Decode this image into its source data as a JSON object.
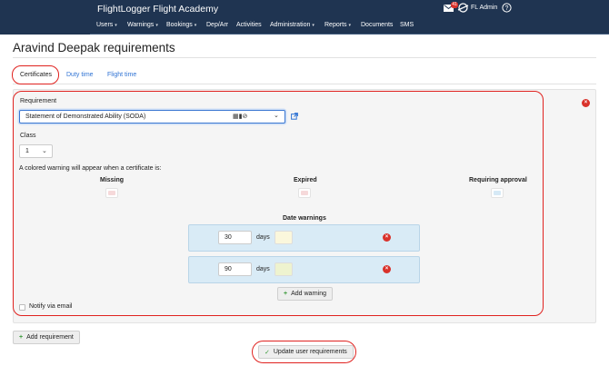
{
  "app": {
    "brand": "FlightLogger Flight Academy",
    "user_name": "FL Admin",
    "mail_badge": "41",
    "nav": [
      {
        "label": "Users",
        "dropdown": true
      },
      {
        "label": "Warnings",
        "dropdown": true
      },
      {
        "label": "Bookings",
        "dropdown": true
      },
      {
        "label": "Dep/Arr",
        "dropdown": false
      },
      {
        "label": "Activities",
        "dropdown": false
      },
      {
        "label": "Administration",
        "dropdown": true
      },
      {
        "label": "Reports",
        "dropdown": true
      },
      {
        "label": "Documents",
        "dropdown": false
      },
      {
        "label": "SMS",
        "dropdown": false
      }
    ]
  },
  "page": {
    "title": "Aravind Deepak requirements",
    "tabs": [
      {
        "label": "Certificates",
        "active": true
      },
      {
        "label": "Duty time",
        "active": false
      },
      {
        "label": "Flight time",
        "active": false
      }
    ]
  },
  "form": {
    "requirement_label": "Requirement",
    "requirement_value": "Statement of Demonstrated Ability (SODA)",
    "class_label": "Class",
    "class_value": "1",
    "warning_intro": "A colored warning will appear when a certificate is:",
    "status_missing": "Missing",
    "status_expired": "Expired",
    "status_requiring": "Requiring approval",
    "date_warnings_title": "Date warnings",
    "date_warnings": [
      {
        "value": "30",
        "unit": "days",
        "color": "#fbf7dc"
      },
      {
        "value": "90",
        "unit": "days",
        "color": "#eef3cf"
      }
    ],
    "add_warning": "Add warning",
    "notify_label": "Notify via email"
  },
  "actions": {
    "add_requirement": "Add requirement",
    "update": "Update user requirements"
  },
  "colors": {
    "nav_bg": "#1f3451",
    "link": "#2f73d4",
    "missing": "#f6d9da",
    "expired": "#f6d9da",
    "requiring": "#d6e9f6",
    "danger": "#d9322b",
    "highlight_oval": "#e0221f"
  }
}
